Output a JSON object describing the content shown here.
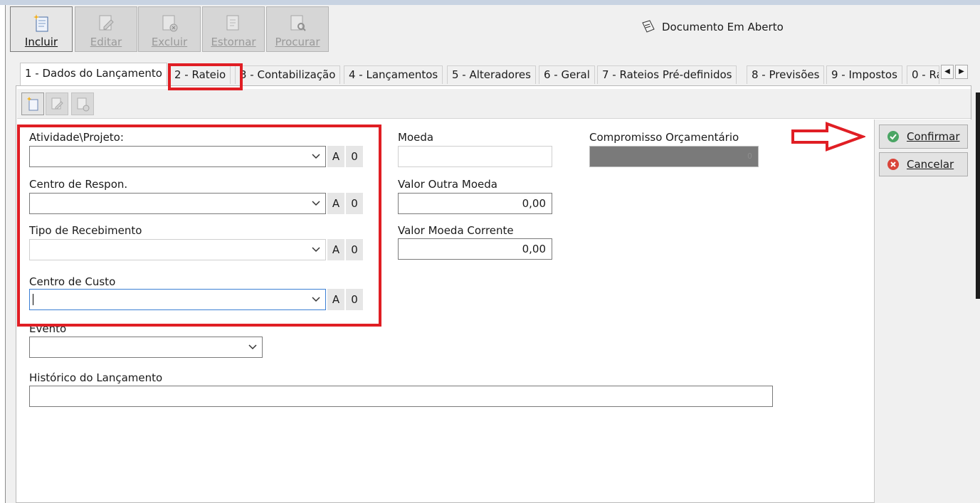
{
  "toolbar": {
    "buttons": [
      {
        "label": "Incluir",
        "icon": "new-document-icon",
        "enabled": true
      },
      {
        "label": "Editar",
        "icon": "edit-document-icon",
        "enabled": false
      },
      {
        "label": "Excluir",
        "icon": "delete-document-icon",
        "enabled": false
      },
      {
        "label": "Estornar",
        "icon": "reverse-document-icon",
        "enabled": false
      },
      {
        "label": "Procurar",
        "icon": "search-document-icon",
        "enabled": false
      }
    ]
  },
  "status": {
    "text": "Documento Em Aberto",
    "icon": "document-status-icon"
  },
  "tabs": [
    {
      "label": "1 - Dados do Lançamento",
      "selected": true
    },
    {
      "label": "2 - Rateio"
    },
    {
      "label": "3 - Contabilização"
    },
    {
      "label": "4 - Lançamentos"
    },
    {
      "label": "5 - Alteradores"
    },
    {
      "label": "6 - Geral"
    },
    {
      "label": "7 - Rateios Pré-definidos"
    },
    {
      "label": "8 - Previsões"
    },
    {
      "label": "9 - Impostos"
    },
    {
      "label": "0 - Ra"
    }
  ],
  "form": {
    "atividade": {
      "label": "Atividade\\Projeto:",
      "value": "",
      "btn_a": "A",
      "btn_0": "0"
    },
    "centro_respon": {
      "label": "Centro de Respon.",
      "value": "",
      "btn_a": "A",
      "btn_0": "0"
    },
    "tipo_recebimento": {
      "label": "Tipo de Recebimento",
      "value": "",
      "btn_a": "A",
      "btn_0": "0"
    },
    "centro_custo": {
      "label": "Centro de Custo",
      "value": "",
      "btn_a": "A",
      "btn_0": "0"
    },
    "evento": {
      "label": "Evento",
      "value": ""
    },
    "historico": {
      "label": "Histórico do Lançamento",
      "value": ""
    },
    "moeda": {
      "label": "Moeda",
      "value": ""
    },
    "valor_outra_moeda": {
      "label": "Valor Outra Moeda",
      "value": "0,00"
    },
    "valor_moeda_corrente": {
      "label": "Valor Moeda Corrente",
      "value": "0,00"
    },
    "compromisso": {
      "label": "Compromisso Orçamentário",
      "value": "0"
    }
  },
  "actions": {
    "confirmar": "Confirmar",
    "cancelar": "Cancelar"
  },
  "annotation_color": "#e01e24"
}
